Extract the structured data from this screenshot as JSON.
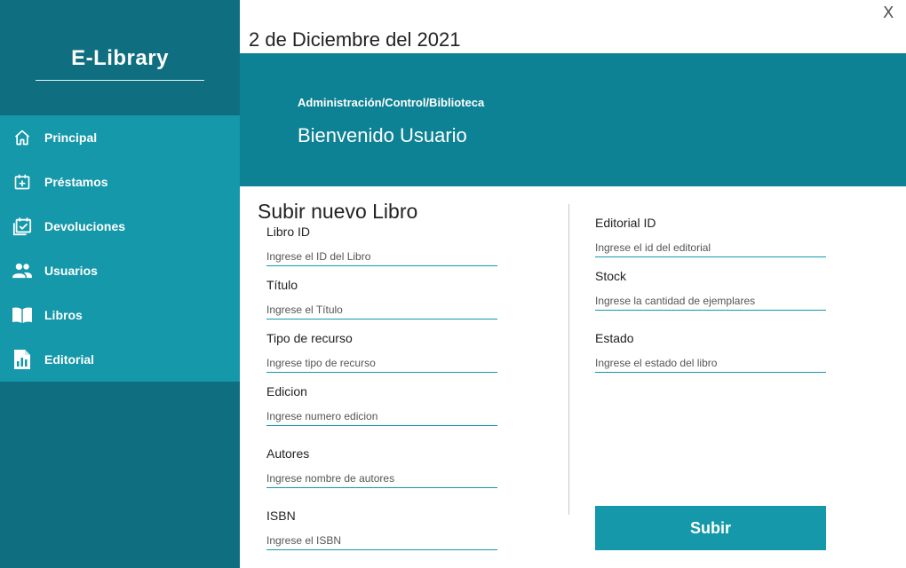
{
  "app": {
    "brand": "E-Library",
    "close_label": "X"
  },
  "sidebar": {
    "items": [
      {
        "label": "Principal",
        "icon": "home-icon"
      },
      {
        "label": "Préstamos",
        "icon": "calendar-plus-icon"
      },
      {
        "label": "Devoluciones",
        "icon": "calendar-check-icon"
      },
      {
        "label": "Usuarios",
        "icon": "users-icon"
      },
      {
        "label": "Libros",
        "icon": "book-open-icon"
      },
      {
        "label": "Editorial",
        "icon": "report-icon"
      }
    ]
  },
  "header": {
    "date": "2 de Diciembre del 2021",
    "breadcrumb": "Administración/Control/Biblioteca",
    "welcome": "Bienvenido Usuario"
  },
  "form": {
    "title": "Subir nuevo Libro",
    "submit_label": "Subir",
    "left_fields": [
      {
        "label": "Libro ID",
        "placeholder": "Ingrese el ID del Libro",
        "value": ""
      },
      {
        "label": "Título",
        "placeholder": "Ingrese el Título",
        "value": ""
      },
      {
        "label": "Tipo de recurso",
        "placeholder": "Ingrese tipo de recurso",
        "value": ""
      },
      {
        "label": "Edicion",
        "placeholder": "Ingrese numero edicion",
        "value": ""
      },
      {
        "label": "Autores",
        "placeholder": "Ingrese nombre de autores",
        "value": ""
      },
      {
        "label": "ISBN",
        "placeholder": "Ingrese el ISBN",
        "value": ""
      }
    ],
    "right_fields": [
      {
        "label": "Editorial ID",
        "placeholder": "Ingrese el id del editorial",
        "value": ""
      },
      {
        "label": "Stock",
        "placeholder": "Ingrese la cantidad de ejemplares",
        "value": ""
      },
      {
        "label": "Estado",
        "placeholder": "Ingrese el estado del libro",
        "value": ""
      }
    ]
  },
  "colors": {
    "sidebar_dark": "#0f6f80",
    "sidebar_nav": "#1598aa",
    "banner": "#0d8294",
    "accent": "#1598aa"
  }
}
